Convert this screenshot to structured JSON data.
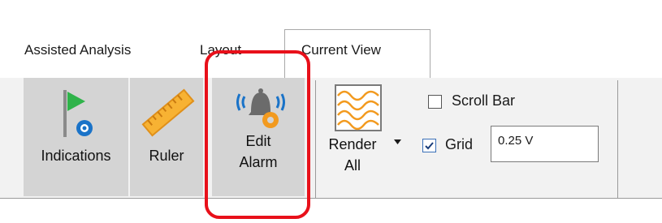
{
  "tabs": [
    {
      "label": "Assisted Analysis",
      "active": false
    },
    {
      "label": "Layout",
      "active": false
    },
    {
      "label": "Current View",
      "active": true
    }
  ],
  "ribbon": {
    "indications": {
      "label": "Indications",
      "icon": "flag-eye-icon"
    },
    "ruler": {
      "label": "Ruler",
      "icon": "ruler-icon"
    },
    "edit_alarm": {
      "label_line1": "Edit",
      "label_line2": "Alarm",
      "icon": "bell-gear-icon"
    },
    "render_all": {
      "label_line1": "Render",
      "label_line2": "All",
      "icon": "waveform-icon"
    },
    "scroll_bar": {
      "label": "Scroll Bar",
      "checked": false
    },
    "grid": {
      "label": "Grid",
      "checked": true,
      "value": "0.25 V"
    }
  },
  "colors": {
    "highlight": "#e8101a",
    "icon_blue": "#1a73c8",
    "icon_green": "#2fb34a",
    "icon_orange": "#f29a1f"
  }
}
